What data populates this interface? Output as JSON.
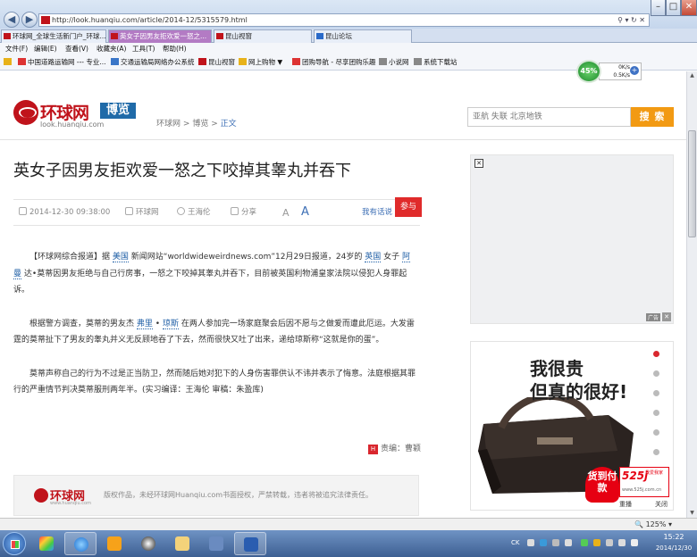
{
  "browser": {
    "url": "http://look.huanqiu.com/article/2014-12/5315579.html",
    "tabs": [
      {
        "label": "环球网_全球生活新门户_环球..."
      },
      {
        "label": "英女子因男友拒欢爱一怒之..."
      },
      {
        "label": "昆山视窗"
      },
      {
        "label": "昆山论坛"
      }
    ],
    "menu": [
      "文件(F)",
      "编辑(E)",
      "查看(V)",
      "收藏夹(A)",
      "工具(T)",
      "帮助(H)"
    ],
    "favorites": [
      "中国道路运输网 --- 专业...",
      "交通运输局网络办公系统",
      "昆山视窗",
      "网上购物 ▼",
      "团购导航 - 尽享团购乐趣",
      "小说网",
      "系统下载站"
    ],
    "net_monitor": {
      "percent": "45%",
      "up": "0K/s",
      "down": "0.5K/s"
    },
    "zoom": "125%"
  },
  "site": {
    "logo_text": "环球网",
    "channel": "博览",
    "logo_url": "look.huanqiu.com",
    "breadcrumb": [
      "环球网",
      "博览",
      "正文"
    ],
    "breadcrumb_sep": ">",
    "search_placeholder": "亚航  失联  北京地铁",
    "search_button": "搜 索"
  },
  "article": {
    "title": "英女子因男友拒欢爱一怒之下咬掉其睾丸并吞下",
    "datetime": "2014-12-30 09:38:00",
    "source": "环球网",
    "author": "王海伦",
    "share": "分享",
    "font_small": "A",
    "font_large": "A",
    "comment": "我有话说",
    "join": "参与",
    "p1_a": "【环球网综合报道】据",
    "p1_k1": "美国",
    "p1_b": "新闻网站“worldwideweirdnews.com”12月29日报道，24岁的",
    "p1_k2": "英国",
    "p1_c": "女子",
    "p1_k3": "阿曼",
    "p1_d": "达•莫蒂因男友拒绝与自己行房事，一怒之下咬掉其睾丸并吞下，目前被英国利物浦皇家法院以侵犯人身罪起诉。",
    "p2_a": "根据警方调查，莫蒂的男友杰",
    "p2_k1": "弗里",
    "p2_b": "•",
    "p2_k2": "琼斯",
    "p2_c": "在两人参加完一场家庭聚会后因不愿与之做爱而遭此厄运。大发雷霆的莫蒂扯下了男友的睾丸并义无反顾地吞了下去，然而很快又吐了出来，递给琼斯称“这就是你的蛋”。",
    "p3": "莫蒂声称自己的行为不过是正当防卫，然而随后她对犯下的人身伤害罪供认不讳并表示了悔意。法庭根据其罪行的严重情节判决莫蒂服刑两年半。(实习编译：王海伦  审稿：朱盈库)",
    "editor": "责编：曹颖"
  },
  "footer": {
    "logo_text": "环球网",
    "logo_url": "www.huanqiu.com",
    "copyright": "版权作品，未经环球网Huanqiu.com书面授权，严禁转载，违者将被追究法律责任。"
  },
  "ads": {
    "top_label": "广告",
    "line1": "我很贵",
    "line2": "但真的很好!",
    "promo": "货到付款",
    "brand": "525j",
    "brand_tag": "我爱我家",
    "brand_url": "www.525j.com.cn",
    "replay": "重播",
    "close": "关闭",
    "dots": 6
  },
  "taskbar": {
    "lang": "CK",
    "time": "15:22",
    "date": "2014/12/30"
  }
}
